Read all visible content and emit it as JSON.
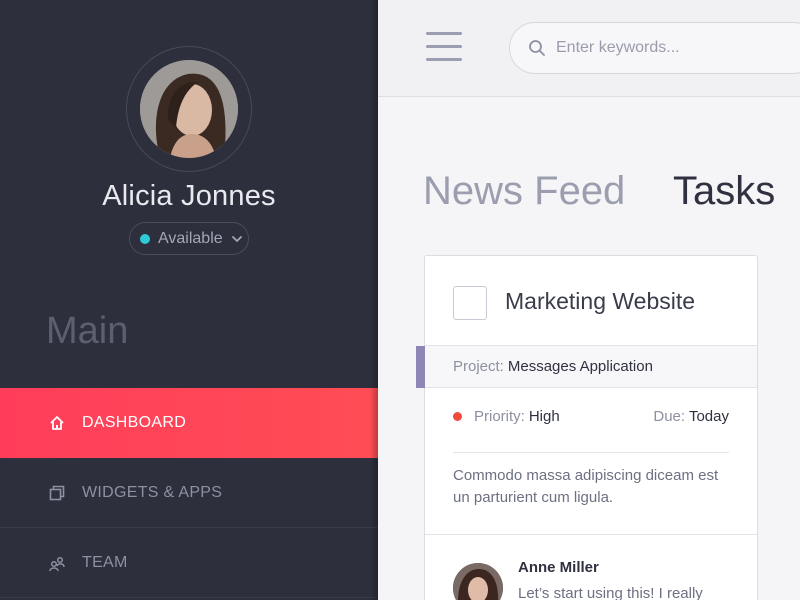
{
  "user": {
    "name": "Alicia Jonnes",
    "status": "Available"
  },
  "sidebar": {
    "section_title": "Main",
    "items": [
      {
        "label": "DASHBOARD",
        "icon": "home-icon",
        "active": true
      },
      {
        "label": "WIDGETS & APPS",
        "icon": "widgets-icon",
        "active": false
      },
      {
        "label": "TEAM",
        "icon": "team-icon",
        "active": false
      }
    ]
  },
  "header": {
    "search_placeholder": "Enter keywords..."
  },
  "tabs": [
    {
      "label": "News Feed",
      "active": false
    },
    {
      "label": "Tasks",
      "active": true
    }
  ],
  "task": {
    "title": "Marketing Website",
    "project_label": "Project:",
    "project_value": "Messages Application",
    "priority_label": "Priority:",
    "priority_value": "High",
    "due_label": "Due:",
    "due_value": "Today",
    "description": "Commodo massa adipiscing diceam est un parturient cum ligula.",
    "comment": {
      "author": "Anne Miller",
      "text": "Let’s start using this! I really"
    }
  },
  "colors": {
    "sidebar_bg": "#2d2f3c",
    "active_nav": "#ff3d5a",
    "status_dot": "#2ec9d6",
    "priority_high": "#ef4b3e",
    "project_accent": "#8f86b8"
  }
}
